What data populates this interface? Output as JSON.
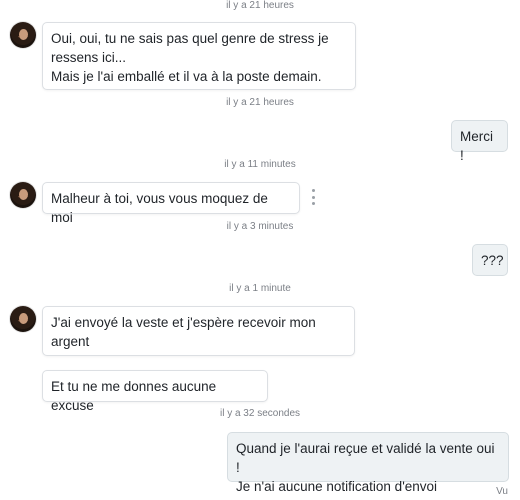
{
  "conversation": {
    "timestamps": [
      "il y a 21 heures",
      "il y a 21 heures",
      "il y a 11 minutes",
      "il y a 3 minutes",
      "il y a 1 minute",
      "il y a 32 secondes"
    ],
    "messages": [
      {
        "from": "them",
        "text": "Oui, oui, tu ne sais pas quel genre de stress je\nressens ici...\nMais je l'ai emballé et il va à la poste demain."
      },
      {
        "from": "me",
        "text": "Merci !"
      },
      {
        "from": "them",
        "text": "Malheur à toi, vous vous moquez de moi"
      },
      {
        "from": "me",
        "text": "???"
      },
      {
        "from": "them",
        "text": "J'ai envoyé la veste et j'espère recevoir mon\nargent"
      },
      {
        "from": "them",
        "text": "Et tu ne me donnes aucune excuse"
      },
      {
        "from": "me",
        "text": "Quand je l'aurai reçue et validé la vente oui !\nJe n'ai aucune notification d'envoi"
      }
    ],
    "read_receipt": "Vu"
  },
  "icons": {
    "avatar": "contact-avatar",
    "more": "more-vertical-icon"
  }
}
